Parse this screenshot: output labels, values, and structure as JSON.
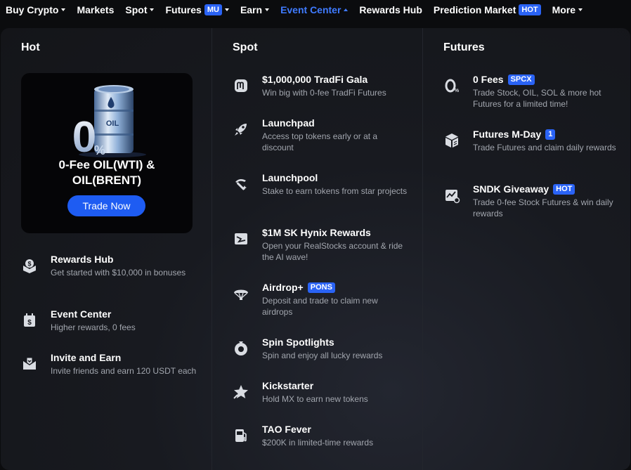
{
  "nav": {
    "items": [
      {
        "label": "Buy Crypto",
        "caret": true
      },
      {
        "label": "Markets",
        "caret": false
      },
      {
        "label": "Spot",
        "caret": true
      },
      {
        "label": "Futures",
        "badge": "MU",
        "caret": true
      },
      {
        "label": "Earn",
        "caret": true
      },
      {
        "label": "Event Center",
        "caret": true,
        "active": true
      },
      {
        "label": "Rewards Hub",
        "caret": false
      },
      {
        "label": "Prediction Market",
        "badge": "HOT",
        "caret": false
      },
      {
        "label": "More",
        "caret": true
      }
    ]
  },
  "hot": {
    "title": "Hot",
    "promo": {
      "title": "0-Fee OIL(WTI) &\nOIL(BRENT)",
      "button": "Trade Now",
      "art_zero": "0",
      "art_pct": "%",
      "art_label": "OIL"
    },
    "items": [
      {
        "title": "Rewards Hub",
        "desc": "Get started with $10,000 in bonuses",
        "icon": "gift-box-icon"
      },
      {
        "title": "Event Center",
        "desc": "Higher rewards, 0 fees",
        "icon": "calendar-dollar-icon"
      },
      {
        "title": "Invite and Earn",
        "desc": "Invite friends and earn 120 USDT each",
        "icon": "invite-envelope-icon"
      }
    ]
  },
  "spot": {
    "title": "Spot",
    "items": [
      {
        "title": "$1,000,000 TradFi Gala",
        "desc": "Win big with 0-fee TradFi Futures",
        "icon": "tradfi-m-icon"
      },
      {
        "title": "Launchpad",
        "desc": "Access top tokens early or at a discount",
        "icon": "rocket-icon"
      },
      {
        "title": "Launchpool",
        "desc": "Stake to earn tokens from star projects",
        "icon": "pickaxe-icon"
      },
      {
        "title": "$1M SK Hynix Rewards",
        "desc": "Open your RealStocks account & ride the AI wave!",
        "icon": "stock-chart-icon"
      },
      {
        "title": "Airdrop+",
        "badge": "PONS",
        "desc": "Deposit and trade to claim new airdrops",
        "icon": "parachute-icon"
      },
      {
        "title": "Spin Spotlights",
        "desc": "Spin and enjoy all lucky rewards",
        "icon": "spin-wheel-icon"
      },
      {
        "title": "Kickstarter",
        "desc": "Hold MX to earn new tokens",
        "icon": "star-badge-icon"
      },
      {
        "title": "TAO Fever",
        "desc": "$200K in limited-time rewards",
        "icon": "fuel-pump-icon"
      }
    ]
  },
  "futures": {
    "title": "Futures",
    "items": [
      {
        "title": "0 Fees",
        "badge": "SPCX",
        "desc": "Trade Stock, OIL, SOL & more hot Futures for a limited time!",
        "icon": "zero-percent-icon"
      },
      {
        "title": "Futures M-Day",
        "badge": "1",
        "desc": "Trade Futures and claim daily rewards",
        "icon": "cube-icon"
      },
      {
        "title": "SNDK Giveaway",
        "badge": "HOT",
        "desc": "Trade 0-fee Stock Futures & win daily rewards",
        "icon": "chart-zero-icon"
      }
    ]
  },
  "colors": {
    "accent": "#2a63f5",
    "active_nav": "#3f7bff",
    "muted_text": "#a2a6ae",
    "panel_bg": "#181a20"
  }
}
